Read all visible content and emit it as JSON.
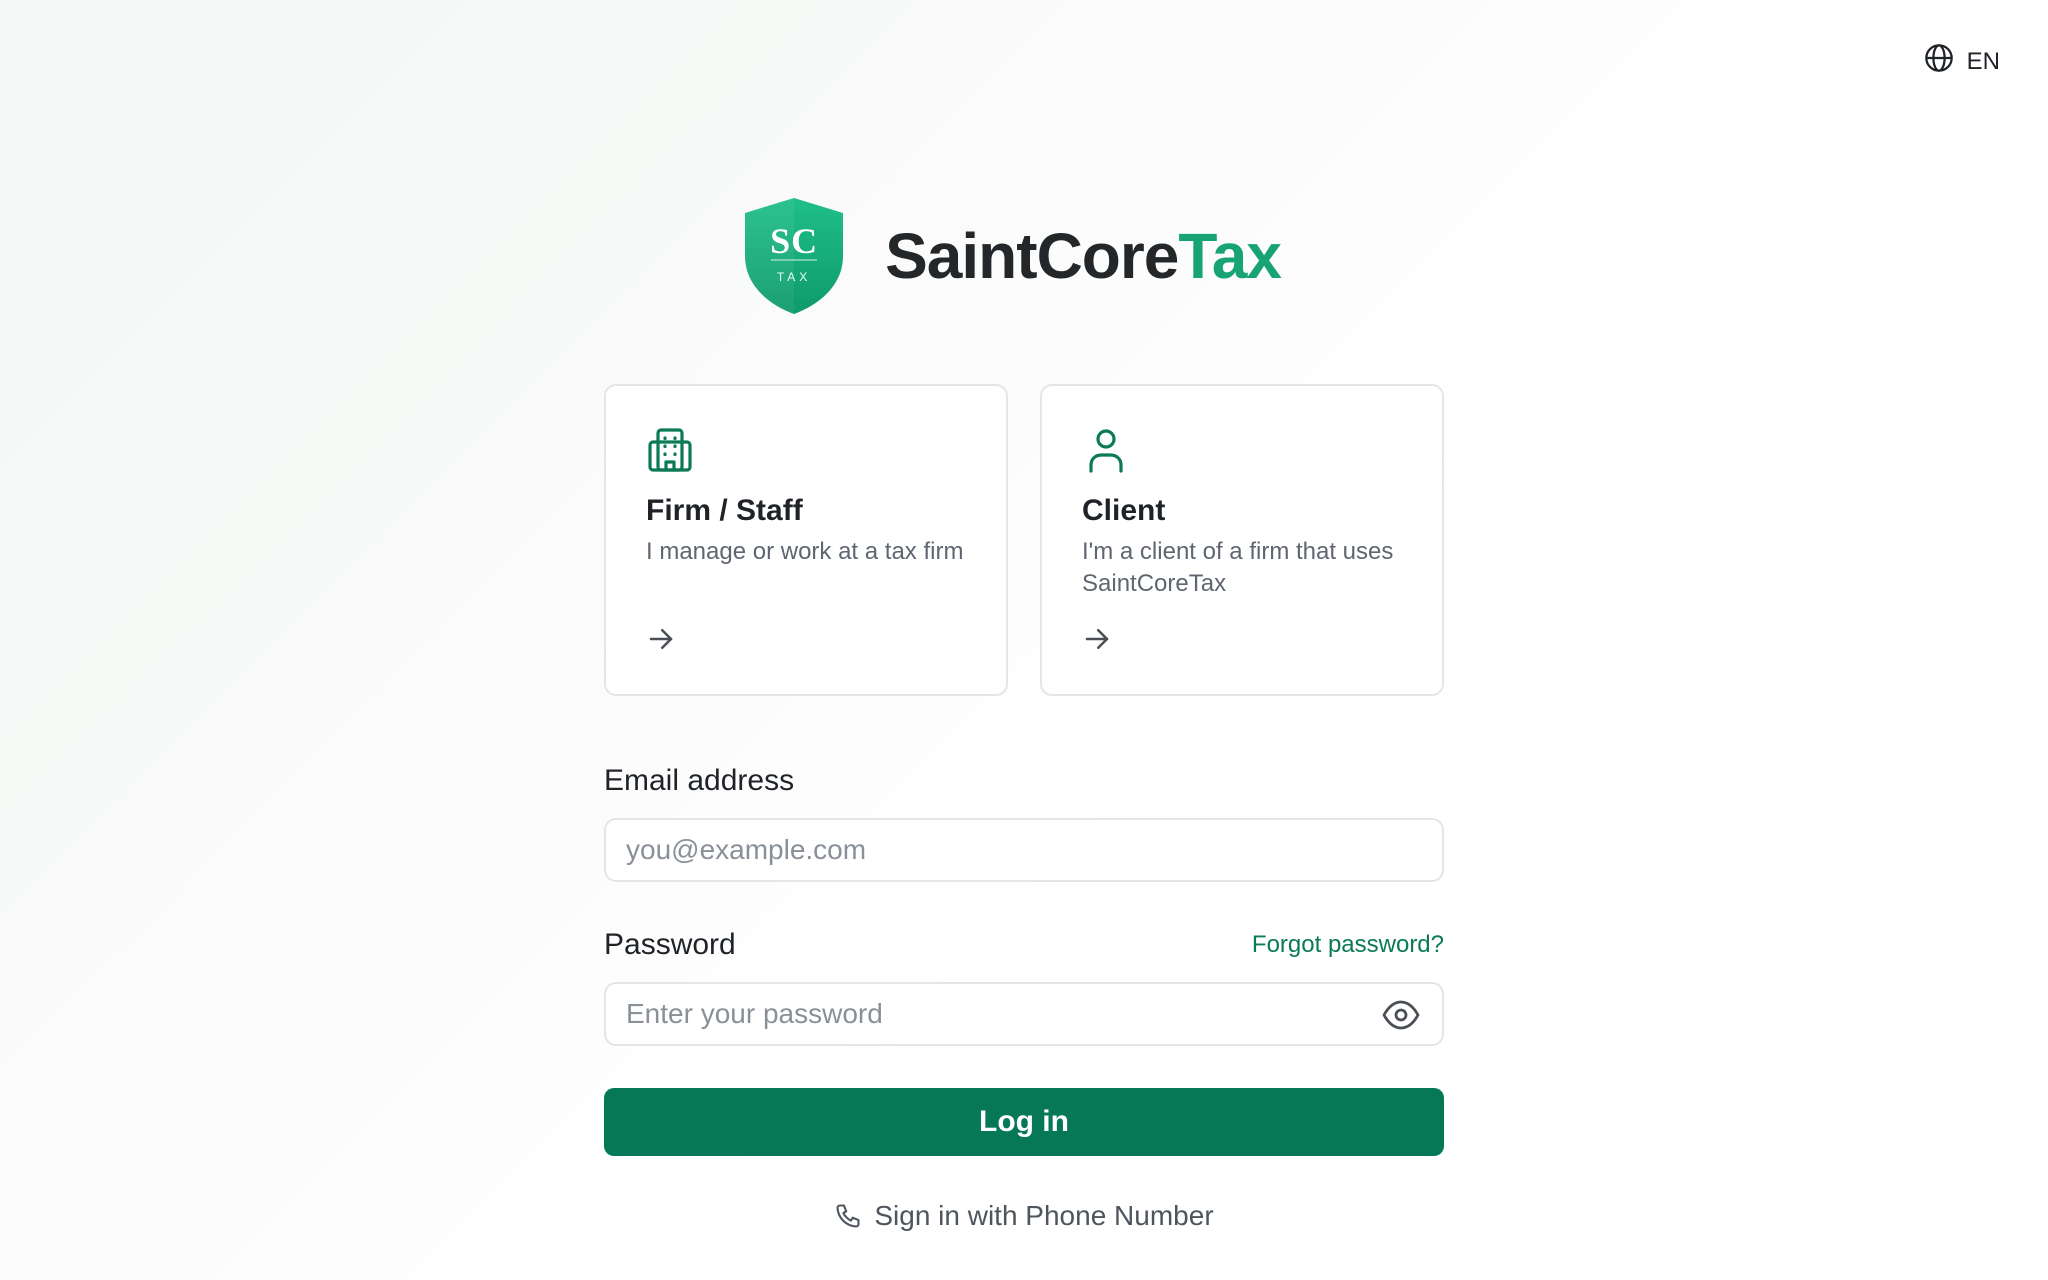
{
  "language": {
    "icon": "globe-icon",
    "code": "EN"
  },
  "brand": {
    "logo_monogram": "SC",
    "logo_subtext": "TAX",
    "name_primary": "SaintCore",
    "name_accent": "Tax",
    "colors": {
      "accent": "#17a374",
      "primary": "#067856",
      "logo_gradient_top": "#1fbf89",
      "logo_gradient_bottom": "#0f9a6b"
    }
  },
  "roles": [
    {
      "icon": "building-icon",
      "title": "Firm / Staff",
      "description": "I manage or work at a tax firm",
      "arrow_icon": "arrow-right-icon"
    },
    {
      "icon": "user-icon",
      "title": "Client",
      "description": "I'm a client of a firm that uses SaintCoreTax",
      "arrow_icon": "arrow-right-icon"
    }
  ],
  "form": {
    "email_label": "Email address",
    "email_placeholder": "you@example.com",
    "email_value": "",
    "password_label": "Password",
    "forgot_password": "Forgot password?",
    "password_placeholder": "Enter your password",
    "password_value": "",
    "toggle_visibility_icon": "eye-icon",
    "submit_label": "Log in"
  },
  "phone_signin": {
    "icon": "phone-icon",
    "label": "Sign in with Phone Number"
  }
}
